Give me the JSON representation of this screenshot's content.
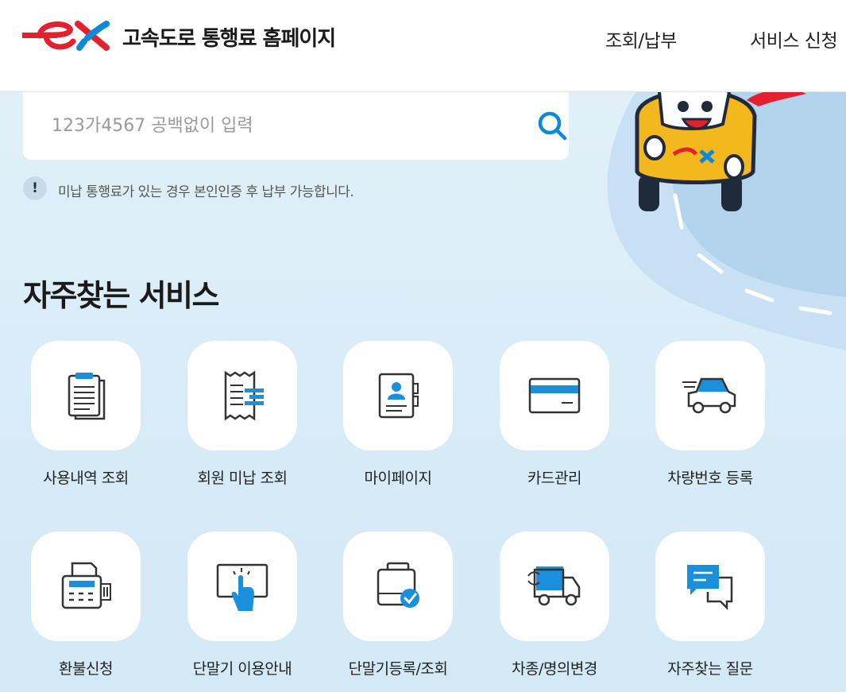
{
  "header": {
    "title": "고속도로 통행료 홈페이지",
    "nav": [
      "조회/납부",
      "서비스 신청"
    ]
  },
  "search": {
    "placeholder": "123가4567 공백없이 입력",
    "value": ""
  },
  "notice": {
    "icon_text": "!",
    "text": "미납 통행료가 있는 경우 본인인증 후 납부 가능합니다."
  },
  "favorites": {
    "title": "자주찾는 서비스",
    "items": [
      {
        "label": "사용내역 조회",
        "icon": "document-list-icon"
      },
      {
        "label": "회원 미납 조회",
        "icon": "receipt-icon"
      },
      {
        "label": "마이페이지",
        "icon": "profile-card-icon"
      },
      {
        "label": "카드관리",
        "icon": "credit-card-icon"
      },
      {
        "label": "차량번호 등록",
        "icon": "car-icon"
      },
      {
        "label": "환불신청",
        "icon": "fax-refund-icon"
      },
      {
        "label": "단말기 이용안내",
        "icon": "touch-screen-icon"
      },
      {
        "label": "단말기등록/조회",
        "icon": "device-check-icon"
      },
      {
        "label": "차종/명의변경",
        "icon": "truck-change-icon"
      },
      {
        "label": "자주찾는 질문",
        "icon": "chat-bubble-icon"
      }
    ]
  },
  "colors": {
    "brand_red": "#e5202e",
    "brand_blue": "#0a8ad8",
    "icon_blue": "#1a8fdb",
    "background": "#dbeef8"
  }
}
